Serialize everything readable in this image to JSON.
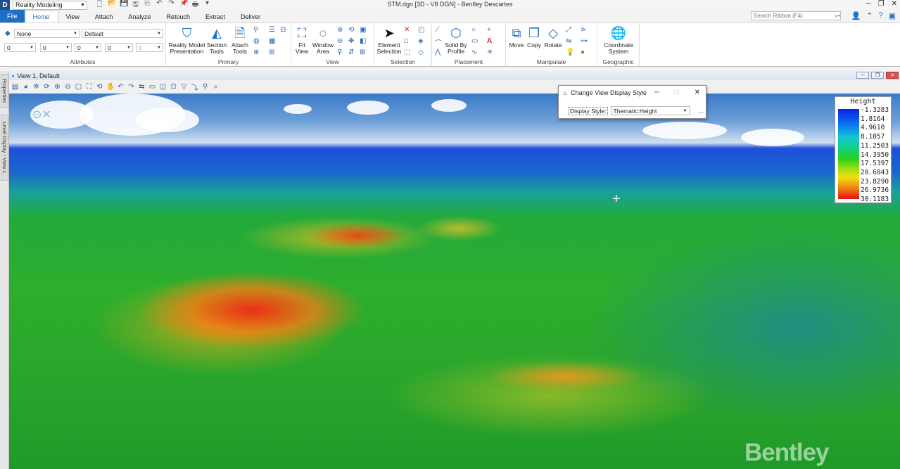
{
  "app": {
    "workspace": "Reality Modeling",
    "title": "STM.dgn [3D - V8 DGN] - Bentley Descartes",
    "search_placeholder": "Search Ribbon (F4)"
  },
  "tabs": [
    "File",
    "Home",
    "View",
    "Attach",
    "Analyze",
    "Retouch",
    "Extract",
    "Deliver"
  ],
  "attributes": {
    "level": "None",
    "style": "Default",
    "color": "0",
    "weight": "0",
    "line": "0",
    "transparency": "0",
    "priority": "0",
    "label": "Attributes"
  },
  "primary": {
    "reality_model": "Reality Model\nPresentation",
    "section": "Section\nTools",
    "attach": "Attach\nTools",
    "label": "Primary"
  },
  "view_group": {
    "fit": "Fit\nView",
    "window": "Window\nArea",
    "label": "View"
  },
  "selection_group": {
    "element": "Element\nSelection",
    "label": "Selection"
  },
  "placement_group": {
    "solid": "Solid By\nProfile",
    "label": "Placement"
  },
  "manipulate_group": {
    "move": "Move",
    "copy": "Copy",
    "rotate": "Rotate",
    "label": "Manipulate"
  },
  "geographic_group": {
    "coord": "Coordinate\nSystem",
    "label": "Geographic"
  },
  "view": {
    "title": "View 1, Default"
  },
  "side_tabs": {
    "properties": "Properties",
    "level_display": "Level Display - View 1"
  },
  "dialog": {
    "title": "Change View Display Style",
    "label": "Display Style:",
    "value": "Thematic:Height",
    "more": "..."
  },
  "legend": {
    "title": "Height",
    "values": [
      "-1.3283",
      "1.8164",
      "4.9610",
      "8.1057",
      "11.2503",
      "14.3950",
      "17.5397",
      "20.6843",
      "23.8290",
      "26.9736",
      "30.1183"
    ]
  },
  "watermark": "Bentley"
}
